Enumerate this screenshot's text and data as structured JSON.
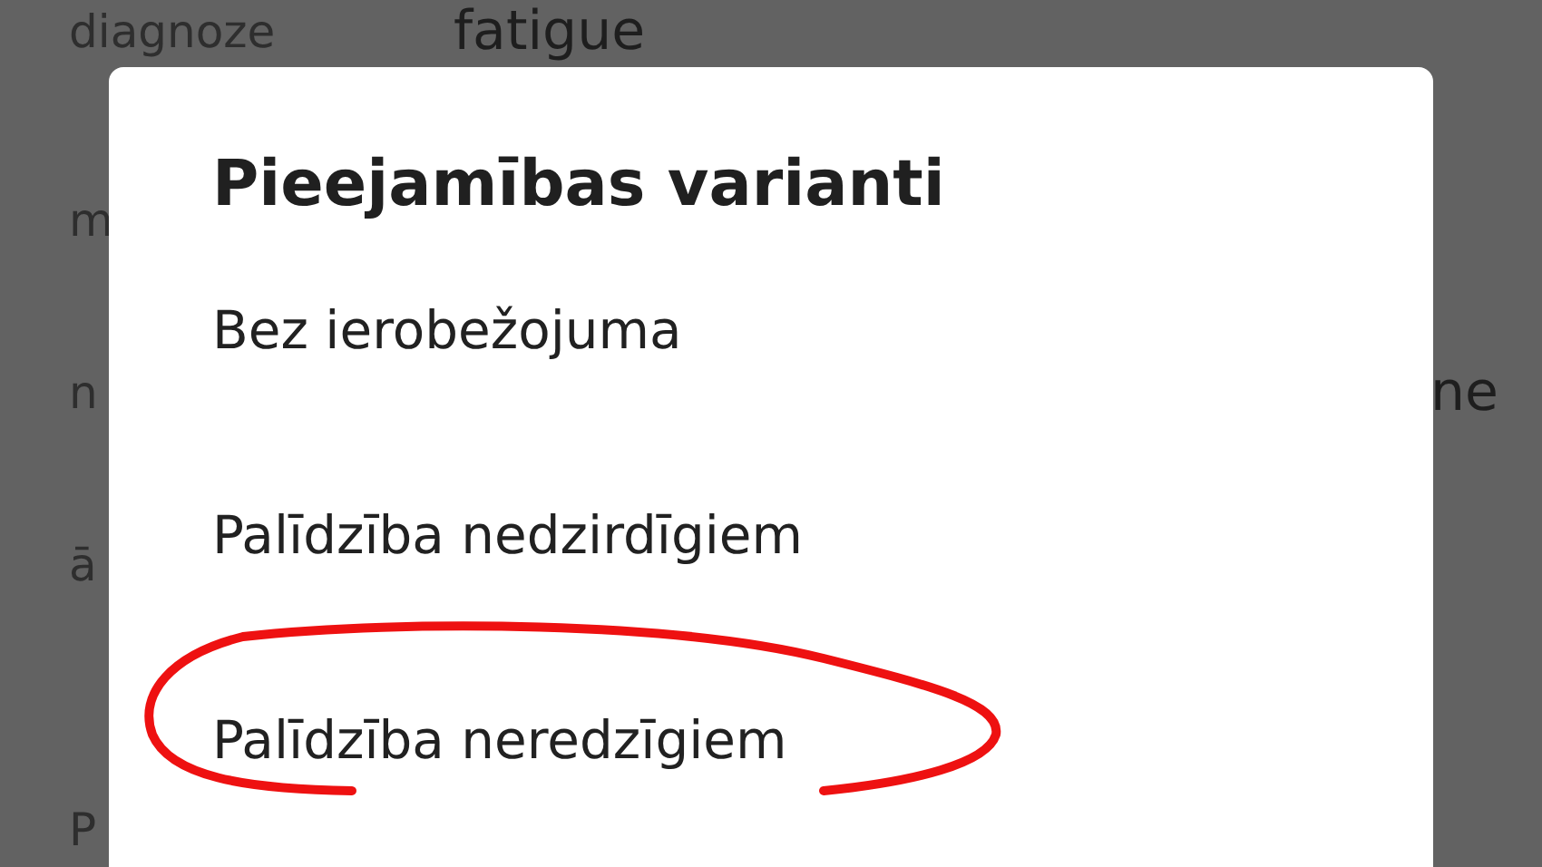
{
  "background": {
    "rows": [
      {
        "label": "diagnoze",
        "value": "fatigue"
      },
      {
        "label": "m"
      },
      {
        "label": "n",
        "value": "ne"
      },
      {
        "label": "ā"
      },
      {
        "label": "P"
      }
    ]
  },
  "dialog": {
    "title": "Pieejamības varianti",
    "options": [
      {
        "label": "Bez ierobežojuma",
        "circled": false
      },
      {
        "label": "Palīdzība nedzirdīgiem",
        "circled": false
      },
      {
        "label": "Palīdzība neredzīgiem",
        "circled": true
      }
    ]
  }
}
